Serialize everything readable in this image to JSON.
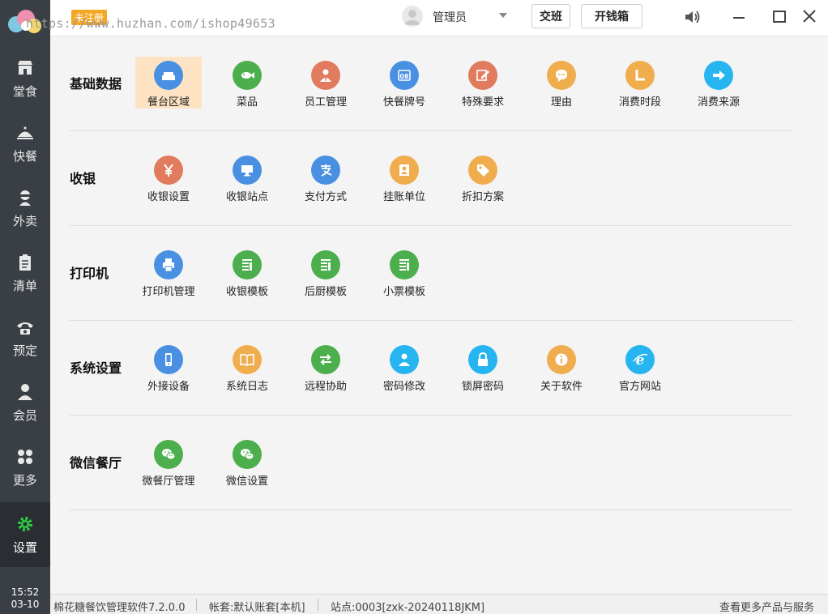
{
  "watermark": "https://www.huzhan.com/ishop49653",
  "header": {
    "register_badge": "未注册",
    "user_name": "管理员",
    "shift_button": "交班",
    "cash_drawer_button": "开钱箱"
  },
  "sidebar": {
    "items": [
      {
        "label": "堂食",
        "icon": "store-icon"
      },
      {
        "label": "快餐",
        "icon": "cloche-icon"
      },
      {
        "label": "外卖",
        "icon": "courier-icon"
      },
      {
        "label": "清单",
        "icon": "clipboard-icon"
      },
      {
        "label": "预定",
        "icon": "phone-icon"
      },
      {
        "label": "会员",
        "icon": "person-icon"
      },
      {
        "label": "更多",
        "icon": "grid-icon"
      },
      {
        "label": "设置",
        "icon": "gear-icon"
      }
    ],
    "active": "设置",
    "clock_time": "15:52",
    "clock_date": "03-10"
  },
  "sections": [
    {
      "title": "基础数据",
      "items": [
        {
          "label": "餐台区域",
          "icon": "sofa-icon",
          "color": "#4a90e2"
        },
        {
          "label": "菜品",
          "icon": "fish-icon",
          "color": "#4cae4c"
        },
        {
          "label": "员工管理",
          "icon": "staff-icon",
          "color": "#e07b5e"
        },
        {
          "label": "快餐牌号",
          "icon": "number-08-icon",
          "color": "#4a90e2"
        },
        {
          "label": "特殊要求",
          "icon": "edit-icon",
          "color": "#e07b5e"
        },
        {
          "label": "理由",
          "icon": "chat-icon",
          "color": "#f0ad4e"
        },
        {
          "label": "消费时段",
          "icon": "clock-icon",
          "color": "#f0ad4e"
        },
        {
          "label": "消费来源",
          "icon": "arrow-right-icon",
          "color": "#26b5f0"
        }
      ]
    },
    {
      "title": "收银",
      "items": [
        {
          "label": "收银设置",
          "icon": "yen-icon",
          "color": "#e07b5e"
        },
        {
          "label": "收银站点",
          "icon": "monitor-icon",
          "color": "#4a90e2"
        },
        {
          "label": "支付方式",
          "icon": "alipay-icon",
          "color": "#4a90e2"
        },
        {
          "label": "挂账单位",
          "icon": "id-card-icon",
          "color": "#f0ad4e"
        },
        {
          "label": "折扣方案",
          "icon": "tag-icon",
          "color": "#f0ad4e"
        }
      ]
    },
    {
      "title": "打印机",
      "items": [
        {
          "label": "打印机管理",
          "icon": "printer-icon",
          "color": "#4a90e2"
        },
        {
          "label": "收银模板",
          "icon": "template-icon",
          "color": "#4cae4c"
        },
        {
          "label": "后厨模板",
          "icon": "template-icon",
          "color": "#4cae4c"
        },
        {
          "label": "小票模板",
          "icon": "template-icon",
          "color": "#4cae4c"
        }
      ]
    },
    {
      "title": "系统设置",
      "items": [
        {
          "label": "外接设备",
          "icon": "mobile-icon",
          "color": "#4a90e2"
        },
        {
          "label": "系统日志",
          "icon": "book-icon",
          "color": "#f0ad4e"
        },
        {
          "label": "远程协助",
          "icon": "swap-icon",
          "color": "#4cae4c"
        },
        {
          "label": "密码修改",
          "icon": "user-key-icon",
          "color": "#26b5f0"
        },
        {
          "label": "锁屏密码",
          "icon": "lock-icon",
          "color": "#26b5f0"
        },
        {
          "label": "关于软件",
          "icon": "info-icon",
          "color": "#f0ad4e"
        },
        {
          "label": "官方网站",
          "icon": "ie-icon",
          "color": "#26b5f0"
        }
      ]
    },
    {
      "title": "微信餐厅",
      "items": [
        {
          "label": "微餐厅管理",
          "icon": "wechat-icon",
          "color": "#4cae4c"
        },
        {
          "label": "微信设置",
          "icon": "wechat-icon",
          "color": "#4cae4c"
        }
      ]
    }
  ],
  "selected_item": "餐台区域",
  "statusbar": {
    "app_version": "棉花糖餐饮管理软件7.2.0.0",
    "account": "帐套:默认账套[本机]",
    "station": "站点:0003[zxk-20240118JKM]",
    "more_products": "查看更多产品与服务"
  }
}
